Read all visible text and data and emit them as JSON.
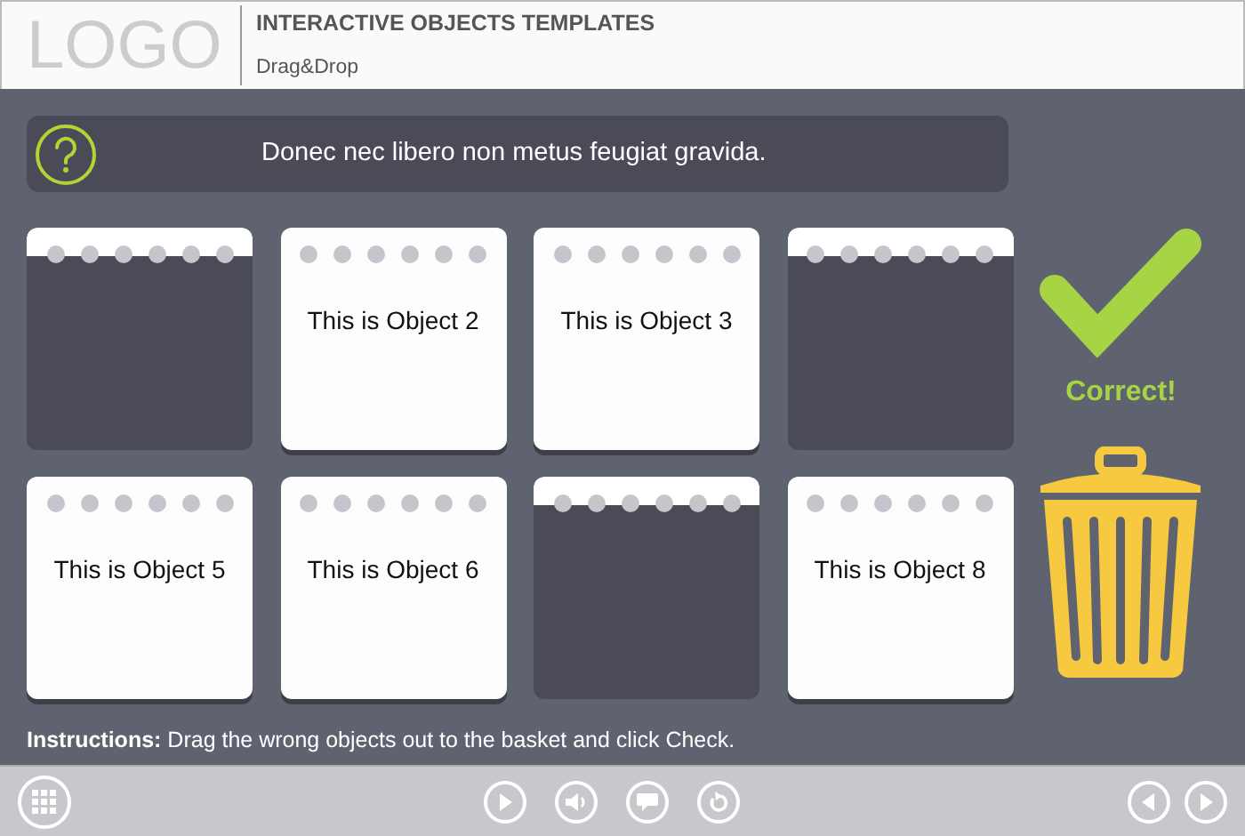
{
  "header": {
    "logo": "LOGO",
    "title": "INTERACTIVE OBJECTS TEMPLATES",
    "subtitle": "Drag&Drop"
  },
  "question": {
    "text": "Donec nec libero non metus feugiat gravida."
  },
  "cards": [
    {
      "kind": "empty"
    },
    {
      "kind": "object",
      "label": "This is Object 2"
    },
    {
      "kind": "object",
      "label": "This is Object 3"
    },
    {
      "kind": "empty"
    },
    {
      "kind": "object",
      "label": "This is Object 5"
    },
    {
      "kind": "object",
      "label": "This is Object 6"
    },
    {
      "kind": "empty"
    },
    {
      "kind": "object",
      "label": "This is Object 8"
    }
  ],
  "feedback": {
    "text": "Correct!"
  },
  "instructions": "**Instructions:** Drag the wrong objects out to the basket and click Check."
}
